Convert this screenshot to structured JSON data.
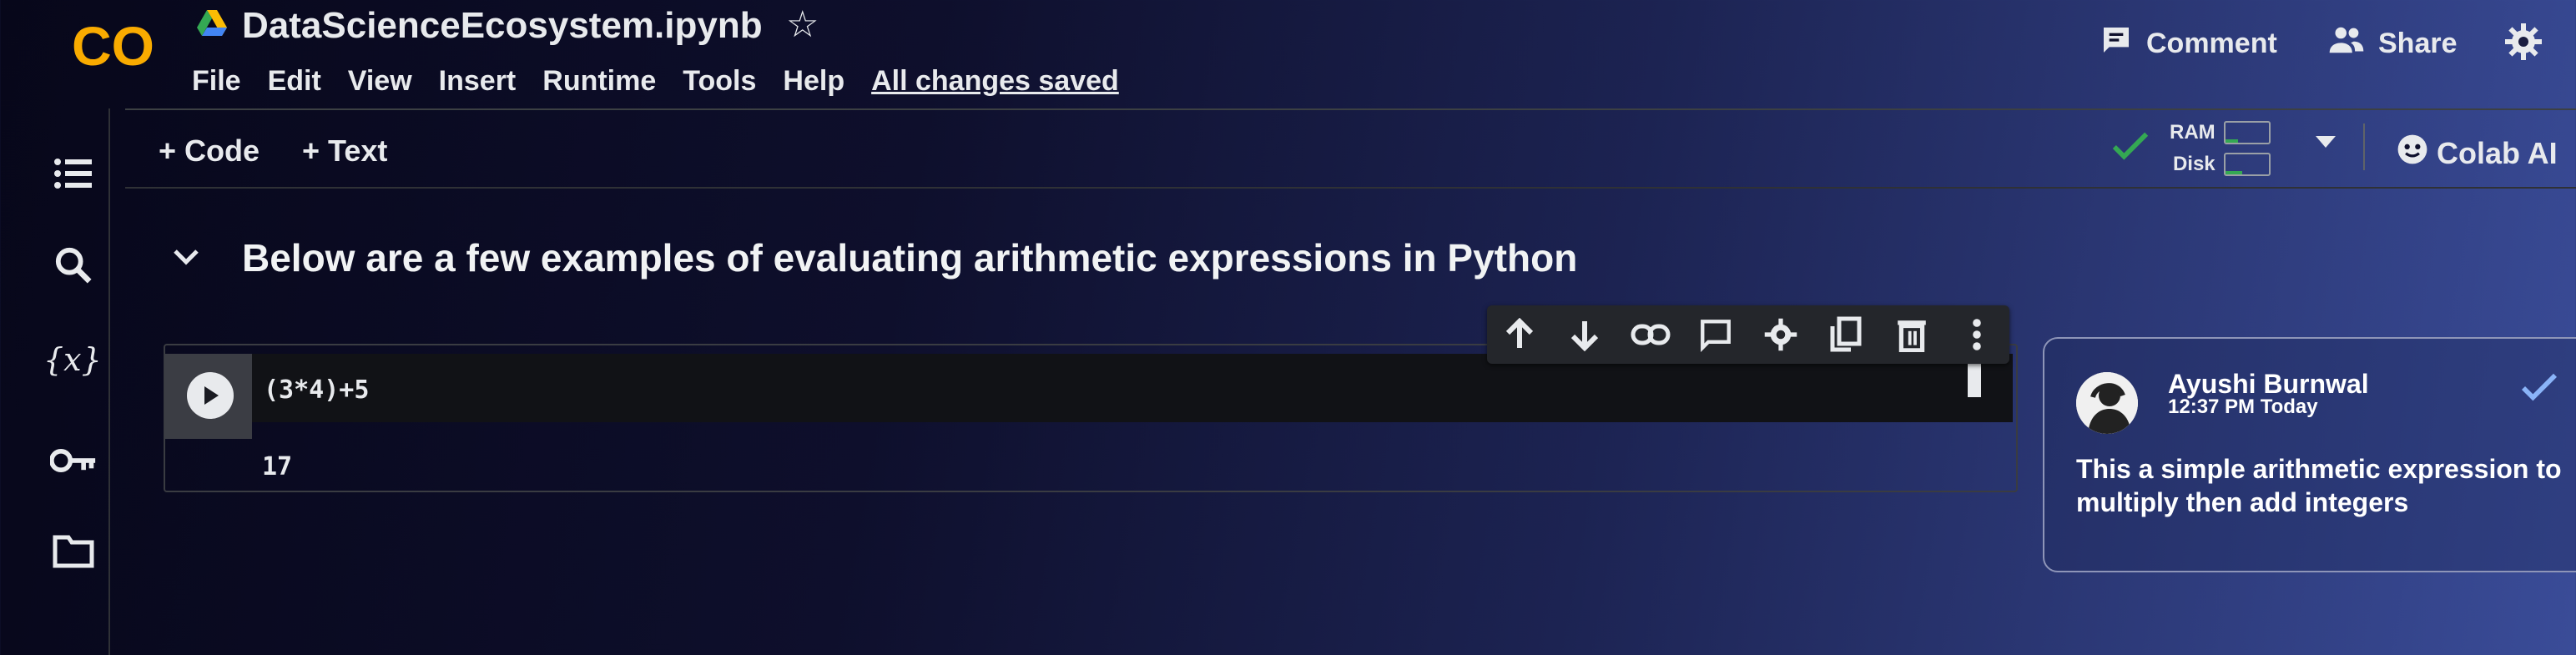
{
  "app": {
    "logo_text": "CO",
    "notebook_title": "DataScienceEcosystem.ipynb"
  },
  "menu": [
    "File",
    "Edit",
    "View",
    "Insert",
    "Runtime",
    "Tools",
    "Help"
  ],
  "save_status": "All changes saved",
  "header_actions": {
    "comment": "Comment",
    "share": "Share"
  },
  "toolbar": {
    "add_code": "+ Code",
    "add_text": "+ Text",
    "ram_label": "RAM",
    "disk_label": "Disk",
    "colab_ai": "Colab AI"
  },
  "text_cell": {
    "heading": "Below are a few examples of evaluating arithmetic expressions in Python"
  },
  "code_cell": {
    "source": "(3*4)+5",
    "output": "17"
  },
  "comment": {
    "author": "Ayushi Burnwal",
    "time": "12:37 PM Today",
    "text": "This a simple arithmetic expression to multiply then add integers"
  },
  "colors": {
    "logo_orange": "#f9ab00",
    "accent_green": "#34a853",
    "link": "#8ab4f8"
  },
  "icons": [
    "table-of-contents-icon",
    "search-icon",
    "variables-icon",
    "key-icon",
    "folder-icon",
    "move-up-icon",
    "move-down-icon",
    "link-icon",
    "comment-icon",
    "settings-icon",
    "mirror-cell-icon",
    "delete-icon",
    "more-icon"
  ]
}
